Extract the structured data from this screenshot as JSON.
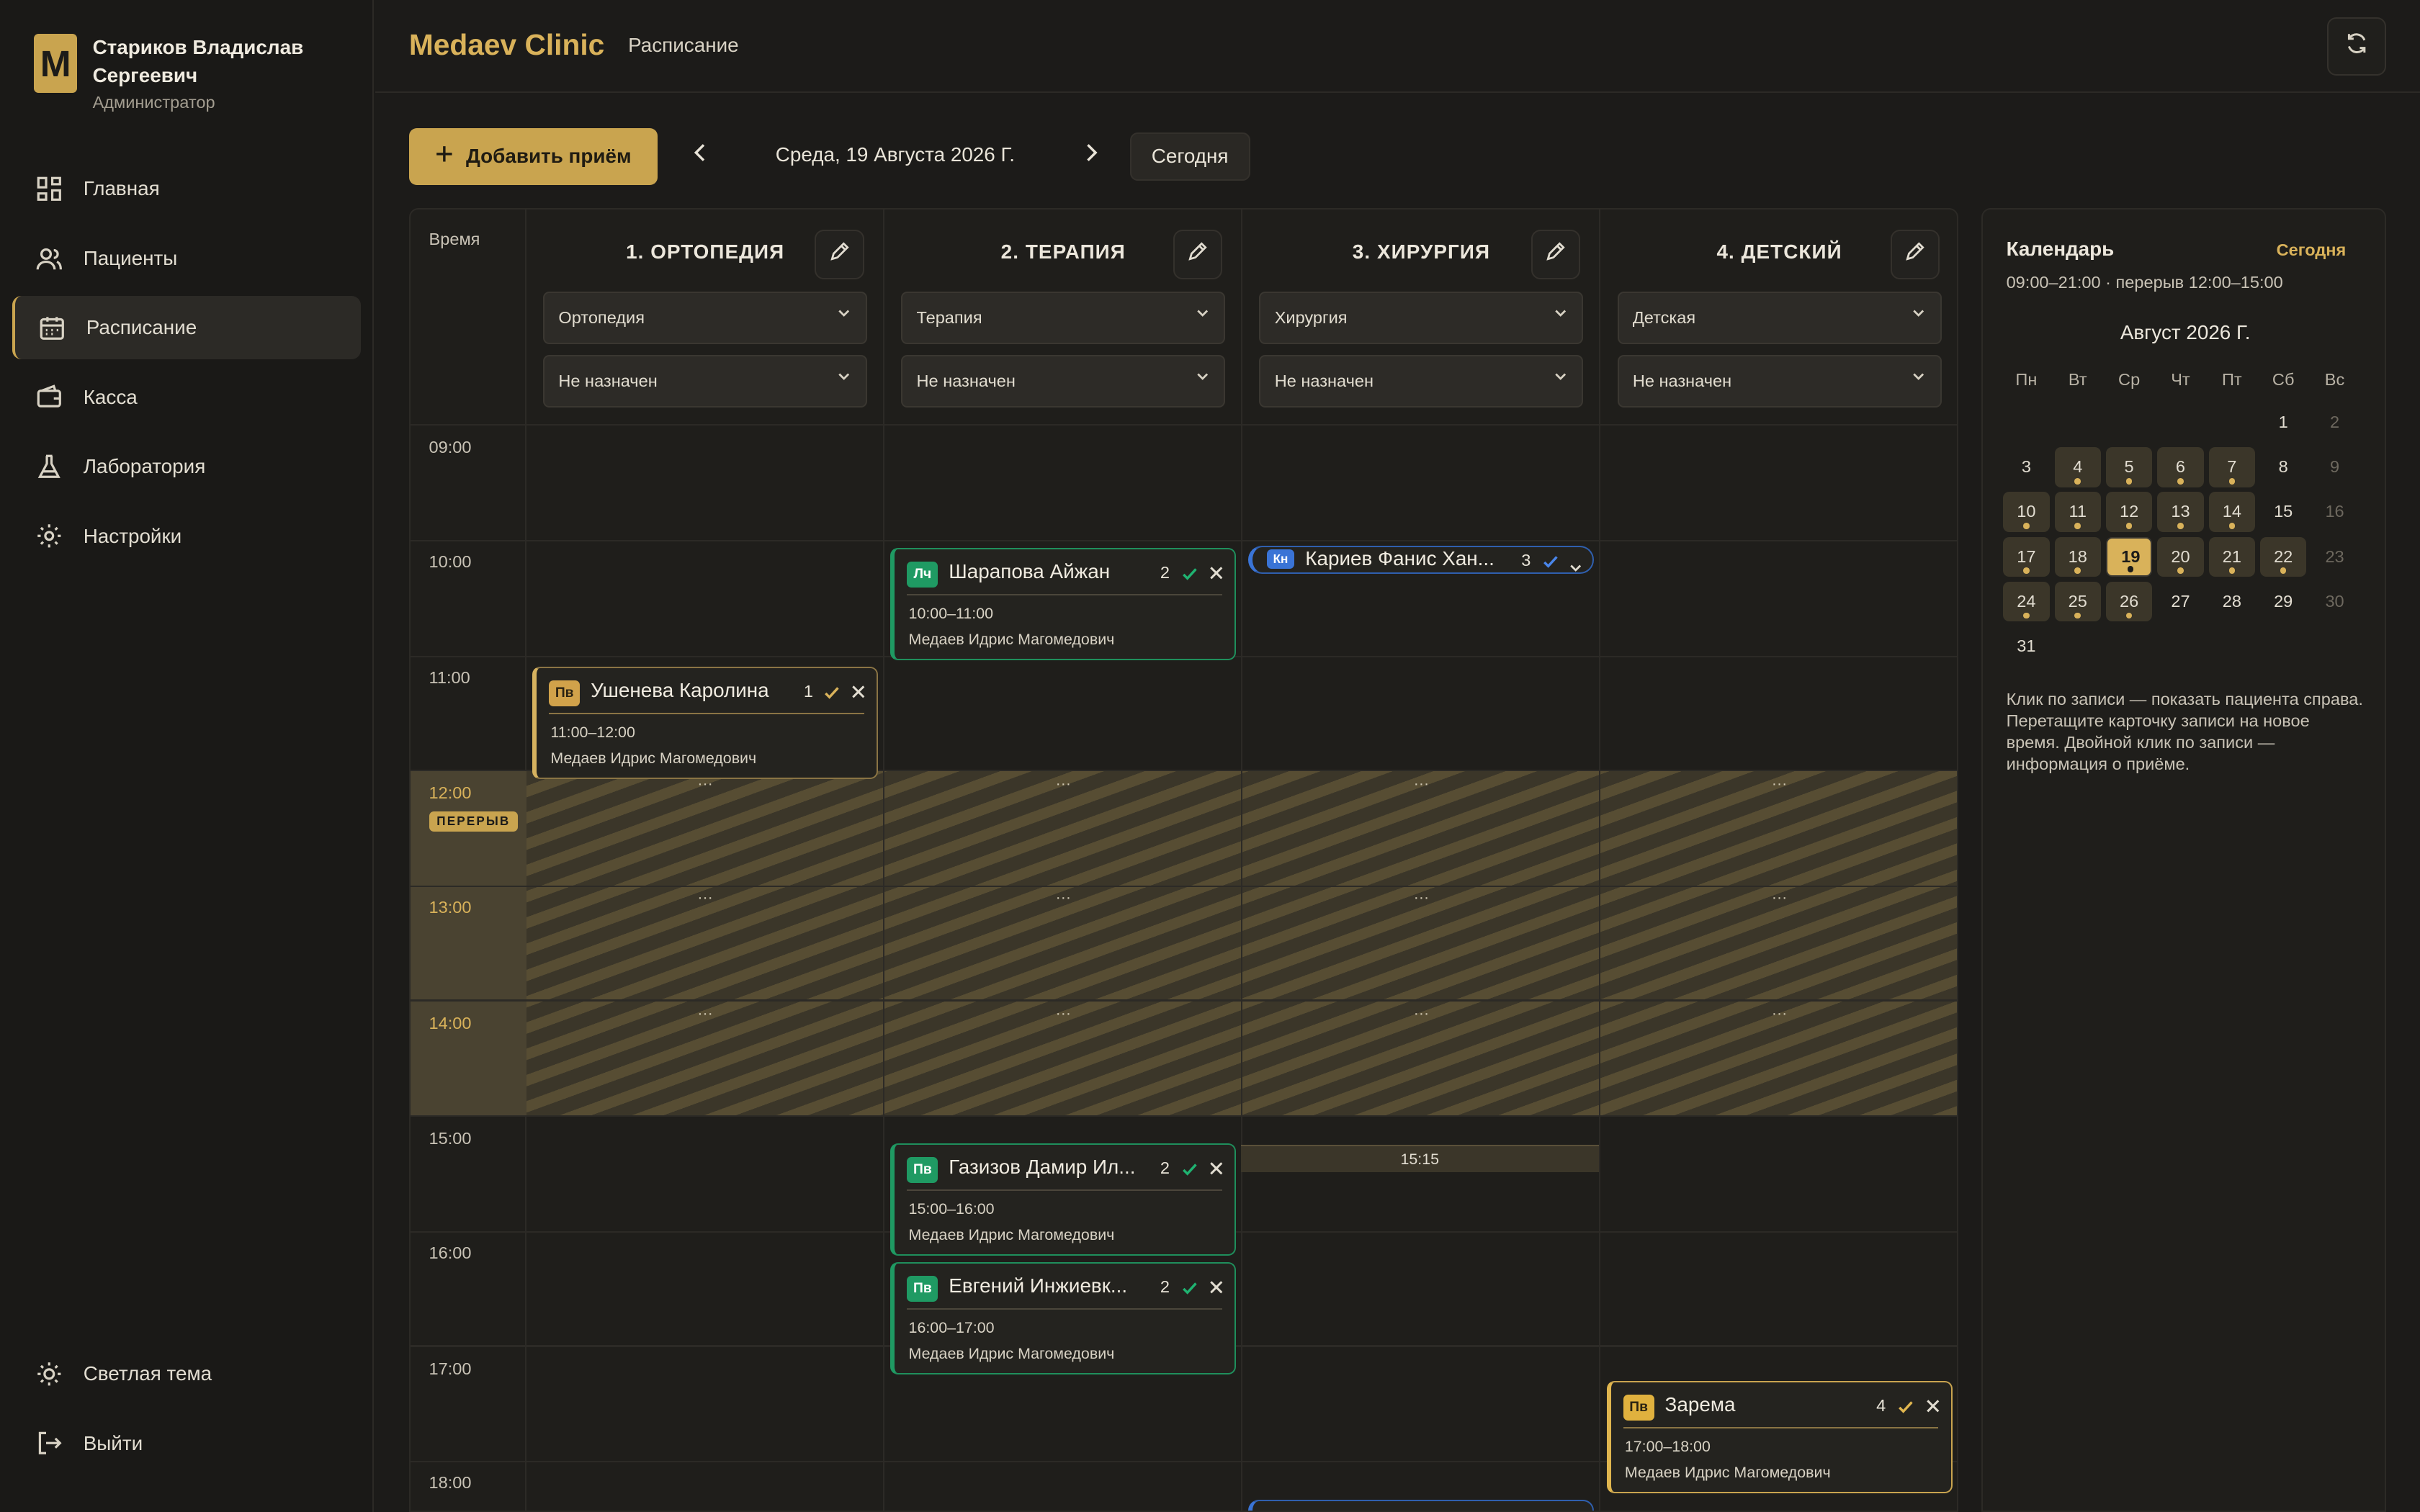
{
  "profile": {
    "initial": "M",
    "name": "Стариков Владислав Сергеевич",
    "role": "Администратор"
  },
  "sidebar": {
    "items": [
      {
        "label": "Главная",
        "icon": "grid-icon"
      },
      {
        "label": "Пациенты",
        "icon": "users-icon"
      },
      {
        "label": "Расписание",
        "icon": "calendar-icon",
        "active": true
      },
      {
        "label": "Касса",
        "icon": "wallet-icon"
      },
      {
        "label": "Лаборатория",
        "icon": "flask-icon"
      },
      {
        "label": "Настройки",
        "icon": "gear-icon"
      }
    ],
    "bottom": [
      {
        "label": "Светлая тема",
        "icon": "sun-icon"
      },
      {
        "label": "Выйти",
        "icon": "logout-icon"
      }
    ]
  },
  "header": {
    "brand": "Medaev Clinic",
    "breadcrumb": "Расписание"
  },
  "toolbar": {
    "add_label": "Добавить приём",
    "date": "Среда, 19 Августа 2026 Г.",
    "today_label": "Сегодня"
  },
  "schedule": {
    "time_header": "Время",
    "break_label": "ПЕРЕРЫВ",
    "times": [
      "09:00",
      "10:00",
      "11:00",
      "12:00",
      "13:00",
      "14:00",
      "15:00",
      "16:00",
      "17:00",
      "18:00"
    ],
    "dots": "···",
    "slot_marker": "15:15",
    "columns": [
      {
        "title": "1. ОРТОПЕДИЯ",
        "specialty": "Ортопедия",
        "doctor": "Не назначен"
      },
      {
        "title": "2. ТЕРАПИЯ",
        "specialty": "Терапия",
        "doctor": "Не назначен"
      },
      {
        "title": "3. ХИРУРГИЯ",
        "specialty": "Хирургия",
        "doctor": "Не назначен"
      },
      {
        "title": "4. ДЕТСКИЙ",
        "specialty": "Детская",
        "doctor": "Не назначен"
      }
    ],
    "appointments": [
      {
        "tag": "Лч",
        "name": "Шарапова Айжан",
        "num": "2",
        "time": "10:00–11:00",
        "doctor": "Медаев Идрис Магомедович"
      },
      {
        "tag": "Кн",
        "name": "Кариев Фанис Хан...",
        "num": "3"
      },
      {
        "tag": "Пв",
        "name": "Ушенева Каролина",
        "num": "1",
        "time": "11:00–12:00",
        "doctor": "Медаев Идрис Магомедович"
      },
      {
        "tag": "Пв",
        "name": "Газизов Дамир Ил...",
        "num": "2",
        "time": "15:00–16:00",
        "doctor": "Медаев Идрис Магомедович"
      },
      {
        "tag": "Пв",
        "name": "Евгений Инжиевк...",
        "num": "2",
        "time": "16:00–17:00",
        "doctor": "Медаев Идрис Магомедович"
      },
      {
        "tag": "Пв",
        "name": "Зарема",
        "num": "4",
        "time": "17:00–18:00",
        "doctor": "Медаев Идрис Магомедович"
      }
    ]
  },
  "calendar": {
    "title": "Календарь",
    "today_label": "Сегодня",
    "hours": "09:00–21:00 · перерыв 12:00–15:00",
    "month": "Август 2026 Г.",
    "weekdays": [
      "Пн",
      "Вт",
      "Ср",
      "Чт",
      "Пт",
      "Сб",
      "Вс"
    ],
    "selected_day": 19,
    "busy_days": [
      4,
      5,
      6,
      7,
      10,
      11,
      12,
      13,
      14,
      17,
      18,
      19,
      20,
      21,
      22,
      24,
      25,
      26
    ],
    "muted_days": [
      2,
      9,
      16,
      23,
      30
    ],
    "hint": "Клик по записи — показать пациента справа. Перетащите карточку записи на новое время. Двойной клик по записи — информация о приёме."
  },
  "colors": {
    "accent": "#c9a44f",
    "green": "#1f9a63",
    "blue": "#3a74d6",
    "background": "#1c1b19"
  }
}
